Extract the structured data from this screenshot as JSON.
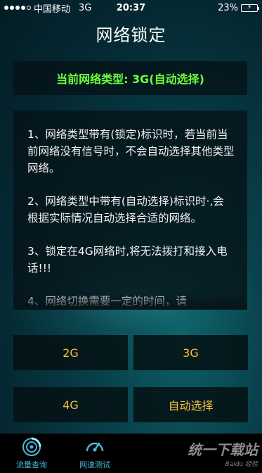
{
  "status_bar": {
    "carrier": "中国移动",
    "network": "3G",
    "time": "20:37",
    "battery": "23%"
  },
  "page_title": "网络锁定",
  "current_network": "当前网络类型: 3G(自动选择)",
  "info": {
    "items": [
      "1、网络类型带有(锁定)标识时，若当前当前网络没有信号时，不会自动选择其他类型网络。",
      "2、网络类型中带有(自动选择)标识时·,会根据实际情况自动选择合适的网络。",
      "3、锁定在4G网络时,将无法拨打和接入电话!!!",
      "4、网络切换需要一定的时间，请"
    ]
  },
  "buttons": {
    "g2": "2G",
    "g3": "3G",
    "g4": "4G",
    "auto": "自动选择"
  },
  "tabs": [
    {
      "label": "流量查询",
      "icon": "traffic-icon"
    },
    {
      "label": "网速测试",
      "icon": "speedometer-icon"
    }
  ],
  "watermark": {
    "text": "统一下载站",
    "sub": "Baidu 经验"
  },
  "colors": {
    "accent_green": "#6dff3a",
    "button_text": "#f3c03a",
    "tab_text": "#4ab7d6"
  }
}
